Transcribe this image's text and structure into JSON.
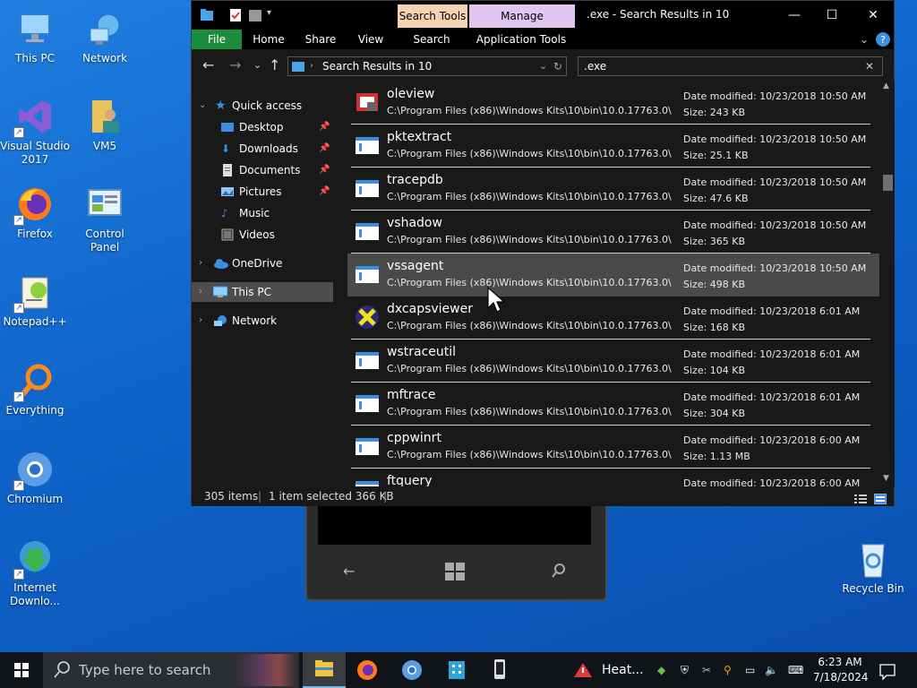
{
  "desktop": {
    "icons": [
      {
        "label": "This PC"
      },
      {
        "label": "Network"
      },
      {
        "label": "Visual Studio 2017"
      },
      {
        "label": "VM5"
      },
      {
        "label": "Firefox"
      },
      {
        "label": "Control Panel"
      },
      {
        "label": "Notepad++"
      },
      {
        "label": "Everything"
      },
      {
        "label": "Chromium"
      },
      {
        "label": "Internet Downlo..."
      },
      {
        "label": "Recycle Bin"
      }
    ]
  },
  "window": {
    "title": ".exe - Search Results in 10",
    "context_tabs": {
      "search_tools": "Search Tools",
      "manage": "Manage"
    },
    "ribbon_tabs": [
      "File",
      "Home",
      "Share",
      "View",
      "Search",
      "Application Tools"
    ],
    "address": "Search Results in 10",
    "search_value": ".exe",
    "nav": {
      "quick_access": "Quick access",
      "items": [
        "Desktop",
        "Downloads",
        "Documents",
        "Pictures",
        "Music",
        "Videos"
      ],
      "onedrive": "OneDrive",
      "this_pc": "This PC",
      "network": "Network"
    },
    "files": [
      {
        "name": "oleview",
        "path": "C:\\Program Files (x86)\\Windows Kits\\10\\bin\\10.0.17763.0\\...",
        "date": "Date modified:  10/23/2018 10:50 AM",
        "size": "Size:  243 KB"
      },
      {
        "name": "pktextract",
        "path": "C:\\Program Files (x86)\\Windows Kits\\10\\bin\\10.0.17763.0\\...",
        "date": "Date modified:  10/23/2018 10:50 AM",
        "size": "Size:  25.1 KB"
      },
      {
        "name": "tracepdb",
        "path": "C:\\Program Files (x86)\\Windows Kits\\10\\bin\\10.0.17763.0\\...",
        "date": "Date modified:  10/23/2018 10:50 AM",
        "size": "Size:  47.6 KB"
      },
      {
        "name": "vshadow",
        "path": "C:\\Program Files (x86)\\Windows Kits\\10\\bin\\10.0.17763.0\\...",
        "date": "Date modified:  10/23/2018 10:50 AM",
        "size": "Size:  365 KB"
      },
      {
        "name": "vssagent",
        "path": "C:\\Program Files (x86)\\Windows Kits\\10\\bin\\10.0.17763.0\\...",
        "date": "Date modified:  10/23/2018 10:50 AM",
        "size": "Size:  498 KB"
      },
      {
        "name": "dxcapsviewer",
        "path": "C:\\Program Files (x86)\\Windows Kits\\10\\bin\\10.0.17763.0\\...",
        "date": "Date modified:  10/23/2018 6:01 AM",
        "size": "Size:  168 KB"
      },
      {
        "name": "wstraceutil",
        "path": "C:\\Program Files (x86)\\Windows Kits\\10\\bin\\10.0.17763.0\\...",
        "date": "Date modified:  10/23/2018 6:01 AM",
        "size": "Size:  104 KB"
      },
      {
        "name": "mftrace",
        "path": "C:\\Program Files (x86)\\Windows Kits\\10\\bin\\10.0.17763.0\\...",
        "date": "Date modified:  10/23/2018 6:01 AM",
        "size": "Size:  304 KB"
      },
      {
        "name": "cppwinrt",
        "path": "C:\\Program Files (x86)\\Windows Kits\\10\\bin\\10.0.17763.0\\...",
        "date": "Date modified:  10/23/2018 6:00 AM",
        "size": "Size:  1.13 MB"
      },
      {
        "name": "ftquery",
        "path": "",
        "date": "Date modified:  10/23/2018 6:00 AM",
        "size": ""
      }
    ],
    "status": {
      "count": "305 items",
      "selected": "1 item selected  366 KB"
    }
  },
  "taskbar": {
    "search_placeholder": "Type here to search",
    "weather": "Heat...",
    "time": "6:23 AM",
    "date": "7/18/2024"
  },
  "colors": {
    "file_tab": "#1c8d3a",
    "search_tools": "#f6d2b3",
    "manage": "#e2c6f2",
    "desktop": "#0f63c8"
  }
}
